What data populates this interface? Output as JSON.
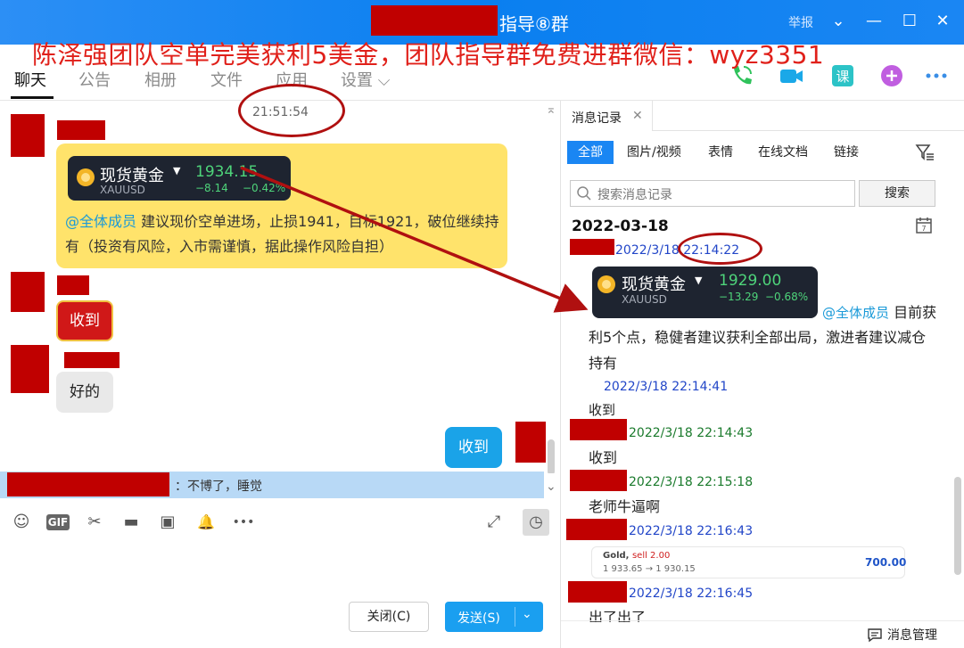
{
  "titlebar": {
    "title": "指导⑧群",
    "report": "举报",
    "min": "—",
    "max": "☐",
    "close": "✕",
    "chevron": "⌄"
  },
  "banner": "陈泽强团队空单完美获利5美金，团队指导群免费进群微信：wyz3351",
  "tabs": [
    "聊天",
    "公告",
    "相册",
    "文件",
    "应用",
    "设置 ⌵"
  ],
  "chat": {
    "time": "21:51:54",
    "stock_card_1": {
      "name": "现货黄金",
      "code": "XAUUSD",
      "price": "1934.15",
      "change": "−8.14",
      "pct": "−0.42%"
    },
    "msg1_mention": "@全体成员",
    "msg1_text": " 建议现价空单进场，止损1941，目标1921，破位继续持有（投资有风险，入市需谨慎，据此操作风险自担）",
    "msg2": "收到",
    "msg3": "好的",
    "msg4": "收到",
    "notif": "：不博了，睡觉"
  },
  "toolbar": {
    "emoji": "☺",
    "gif": "GIF",
    "scissors": "✂",
    "folder": "▬",
    "image": "▣",
    "bell": "🔔",
    "more": "•••",
    "expand": "⤢",
    "history": "◷"
  },
  "buttons": {
    "close": "关闭(C)",
    "send": "发送(S)",
    "send_arrow": "⌄"
  },
  "right": {
    "tab": "消息记录",
    "tab_close": "✕",
    "filters": [
      "全部",
      "图片/视频",
      "表情",
      "在线文档",
      "链接"
    ],
    "search_placeholder": "搜索消息记录",
    "search_button": "搜索",
    "date": "2022-03-18",
    "cal_day": "7",
    "t1": "2022/3/18 22:14:22",
    "stock_card_2": {
      "name": "现货黄金",
      "code": "XAUUSD",
      "price": "1929.00",
      "change": "−13.29",
      "pct": "−0.68%"
    },
    "m1_mention": "@全体成员",
    "m1_a": " 目前获",
    "m1_b": "利5个点，稳健者建议获利全部出局，激进者建议减仓",
    "m1_c": "持有",
    "t2": "2022/3/18 22:14:41",
    "m2": "收到",
    "t3": "2022/3/18 22:14:43",
    "m3": "收到",
    "t4": "2022/3/18 22:15:18",
    "m4": "老师牛逼啊",
    "t5": "2022/3/18 22:16:43",
    "mini_card": {
      "line1_name": "Gold, ",
      "line1_sell": "sell 2.00",
      "line2": "1 933.65 → 1 930.15",
      "price": "700.00"
    },
    "t6": "2022/3/18 22:16:45",
    "m6": "出了出了",
    "msg_mgmt": "消息管理"
  },
  "colors": {
    "accent": "#1a86f3",
    "annotation_red": "#b01010",
    "banner_red": "#e0201a"
  }
}
